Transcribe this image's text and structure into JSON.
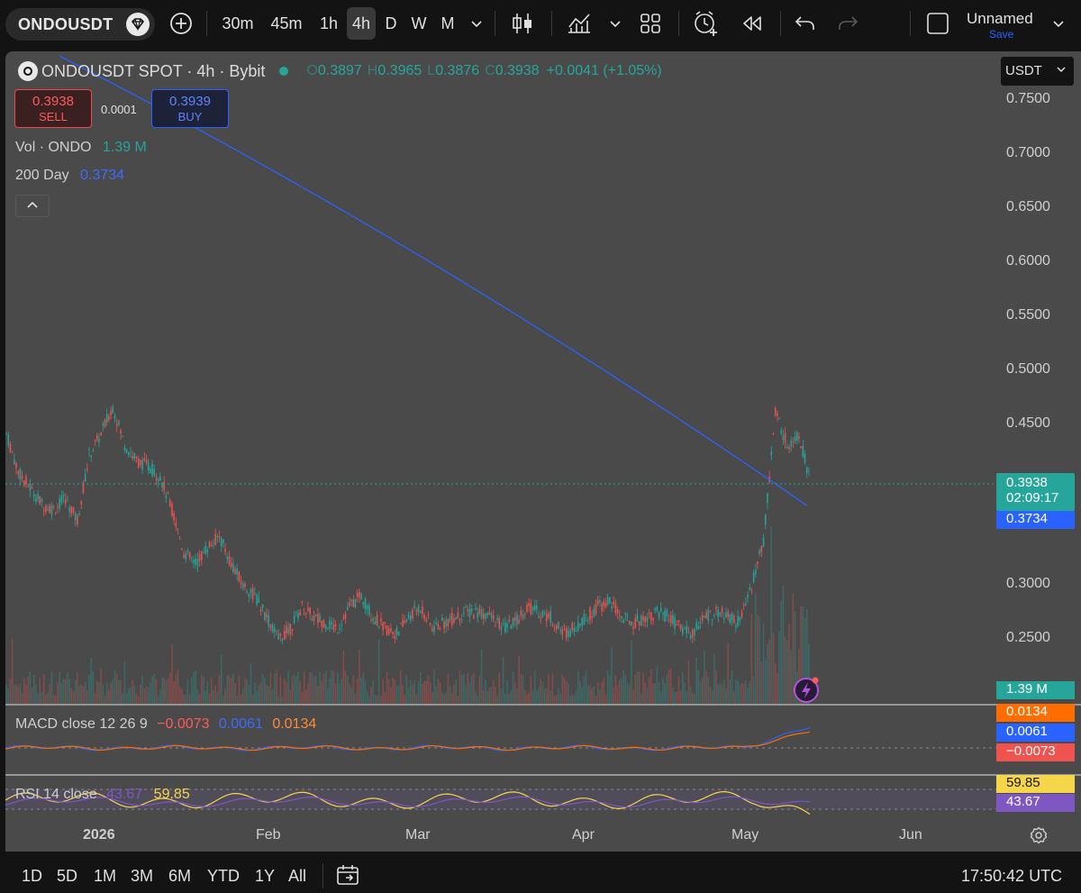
{
  "toolbar": {
    "symbol": "ONDOUSDT",
    "intervals": [
      "30m",
      "45m",
      "1h",
      "4h",
      "D",
      "W",
      "M"
    ],
    "active_interval": "4h",
    "layout_name": "Unnamed",
    "save_label": "Save"
  },
  "legend": {
    "title": "ONDOUSDT SPOT · 4h · Bybit",
    "o_label": "O",
    "o_value": "0.3897",
    "h_label": "H",
    "h_value": "0.3965",
    "l_label": "L",
    "l_value": "0.3876",
    "c_label": "C",
    "c_value": "0.3938",
    "change": "+0.0041 (+1.05%)"
  },
  "trade": {
    "sell_price": "0.3938",
    "sell_label": "SELL",
    "spread": "0.0001",
    "buy_price": "0.3939",
    "buy_label": "BUY"
  },
  "indicators": {
    "vol_label": "Vol · ONDO",
    "vol_value": "1.39 M",
    "ma_label": "200 Day",
    "ma_value": "0.3734",
    "collapse_glyph": "^"
  },
  "currency": "USDT",
  "price_axis": [
    "0.7500",
    "0.7000",
    "0.6500",
    "0.6000",
    "0.5500",
    "0.5000",
    "0.4500",
    "0.3000",
    "0.2500"
  ],
  "tags": {
    "last_price": "0.3938",
    "countdown": "02:09:17",
    "ma_price": "0.3734",
    "volume": "1.39 M",
    "macd_signal": "0.0134",
    "macd_line": "0.0061",
    "macd_hist": "−0.0073",
    "rsi": "59.85",
    "rsi_ma": "43.67"
  },
  "macd": {
    "label": "MACD close 12 26 9",
    "hist": "−0.0073",
    "line": "0.0061",
    "signal": "0.0134"
  },
  "rsi": {
    "label": "RSI 14 close",
    "ma": "43.67",
    "value": "59.85"
  },
  "date_axis": [
    "2026",
    "Feb",
    "Mar",
    "Apr",
    "May",
    "Jun"
  ],
  "ranges": [
    "1D",
    "5D",
    "1M",
    "3M",
    "6M",
    "YTD",
    "1Y",
    "All"
  ],
  "clock": "17:50:42 UTC",
  "colors": {
    "up": "#26a69a",
    "down": "#ef5350",
    "ma": "#2962ff",
    "macd_line": "#2962ff",
    "macd_signal": "#ff6d00",
    "rsi": "#f5d64a",
    "rsi_ma": "#7e57c2"
  },
  "chart_data": {
    "type": "line",
    "y_range": [
      0.21,
      0.78
    ],
    "x_labels": [
      "2026",
      "Feb",
      "Mar",
      "Apr",
      "May",
      "Jun"
    ],
    "price_series": {
      "name": "ONDOUSDT",
      "points": [
        0.44,
        0.405,
        0.39,
        0.375,
        0.37,
        0.38,
        0.36,
        0.42,
        0.44,
        0.465,
        0.43,
        0.415,
        0.41,
        0.4,
        0.37,
        0.33,
        0.32,
        0.335,
        0.345,
        0.32,
        0.3,
        0.29,
        0.27,
        0.25,
        0.26,
        0.28,
        0.27,
        0.265,
        0.26,
        0.28,
        0.29,
        0.27,
        0.26,
        0.255,
        0.27,
        0.28,
        0.26,
        0.265,
        0.27,
        0.275,
        0.275,
        0.27,
        0.26,
        0.265,
        0.28,
        0.275,
        0.27,
        0.255,
        0.26,
        0.27,
        0.28,
        0.285,
        0.27,
        0.265,
        0.27,
        0.275,
        0.27,
        0.26,
        0.255,
        0.27,
        0.275,
        0.27,
        0.265,
        0.3,
        0.34,
        0.46,
        0.43,
        0.44,
        0.3938
      ]
    },
    "ma_series": {
      "name": "200 Day",
      "start": 0.79,
      "end": 0.3734
    }
  }
}
